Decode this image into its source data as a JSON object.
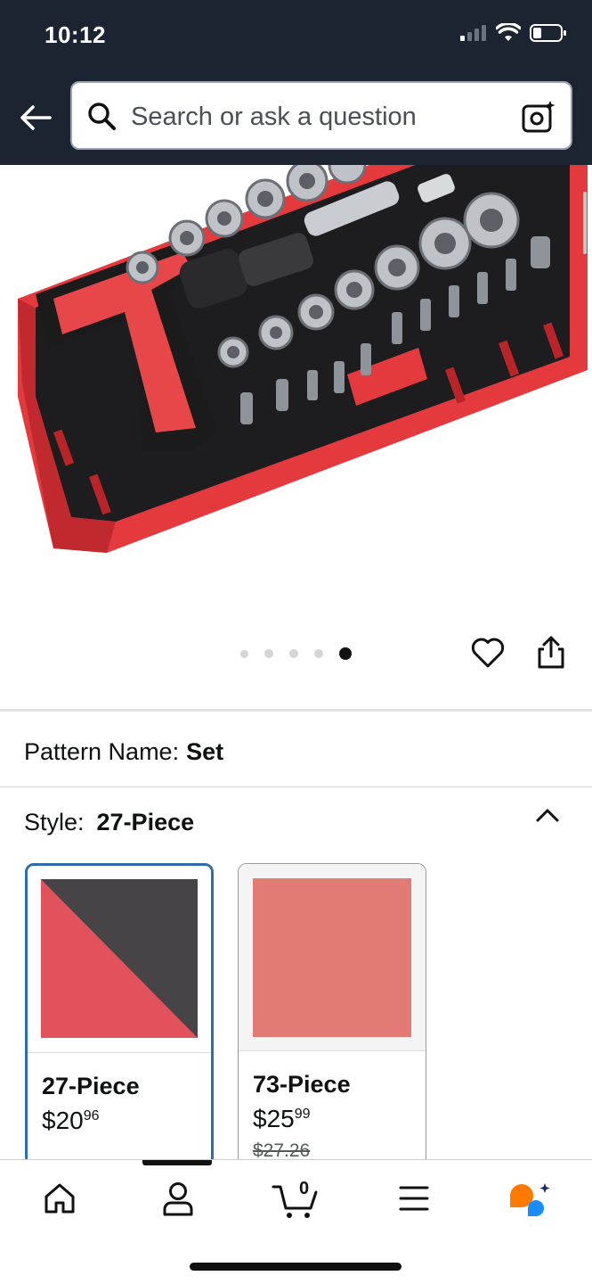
{
  "status_bar": {
    "time": "10:12"
  },
  "search": {
    "placeholder": "Search or ask a question"
  },
  "gallery": {
    "dot_count": 5,
    "active_index": 4
  },
  "pattern": {
    "label": "Pattern Name:",
    "value": "Set"
  },
  "style": {
    "label": "Style:",
    "value": "27-Piece"
  },
  "options": [
    {
      "name": "27-Piece",
      "price_dollars": "$20",
      "price_cents": "96",
      "was_price": "",
      "selected": true
    },
    {
      "name": "73-Piece",
      "price_dollars": "$25",
      "price_cents": "99",
      "was_price": "$27.26",
      "selected": false
    }
  ],
  "nav": {
    "cart_count": "0"
  },
  "colors": {
    "header_bg": "#1c2431",
    "selected_border": "#2d6da8",
    "swatch_red": "#e2525c",
    "swatch_dark": "#464446",
    "swatch_salmon": "#e27a76"
  }
}
